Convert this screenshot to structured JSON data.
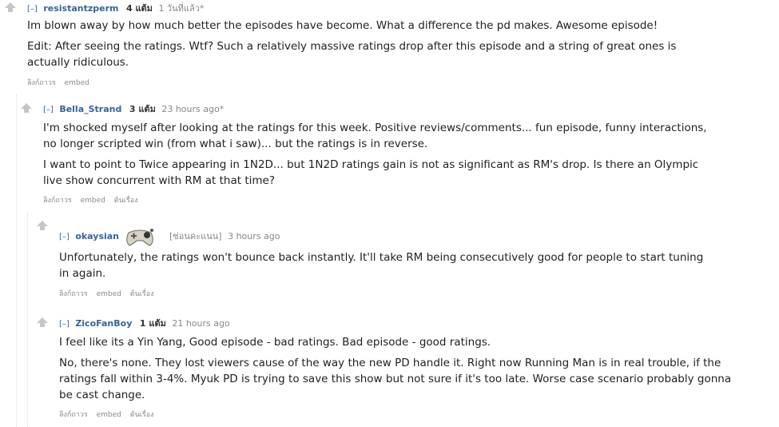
{
  "comments": [
    {
      "toggle": "[–]",
      "author": "resistantzperm",
      "points": "4 แต้ม",
      "time": "1 วันที่แล้ว*",
      "paragraphs": [
        "Im blown away by how much better the episodes have become. What a difference the pd makes. Awesome episode!",
        "Edit: After seeing the ratings. Wtf? Such a relatively massive ratings drop after this episode and a string of great ones is actually ridiculous."
      ],
      "buttons": [
        "ลิงก์ถาวร",
        "embed"
      ]
    },
    {
      "toggle": "[–]",
      "author": "Bella_Strand",
      "points": "3 แต้ม",
      "time": "23 hours ago*",
      "paragraphs": [
        "I'm shocked myself after looking at the ratings for this week. Positive reviews/comments... fun episode, funny interactions, no longer scripted win (from what i saw)... but the ratings is in reverse.",
        "I want to point to Twice appearing in 1N2D... but 1N2D ratings gain is not as significant as RM's drop. Is there an Olympic live show concurrent with RM at that time?"
      ],
      "buttons": [
        "ลิงก์ถาวร",
        "embed",
        "ต้นเรื่อง"
      ]
    },
    {
      "toggle": "[–]",
      "author": "okaysian",
      "hidden_score": "[ซ่อนคะแนน]",
      "time": "3 hours ago",
      "paragraphs": [
        "Unfortunately, the ratings won't bounce back instantly. It'll take RM being consecutively good for people to start tuning in again."
      ],
      "buttons": [
        "ลิงก์ถาวร",
        "embed",
        "ต้นเรื่อง"
      ]
    },
    {
      "toggle": "[–]",
      "author": "ZicoFanBoy",
      "points": "1 แต้ม",
      "time": "21 hours ago",
      "paragraphs": [
        "I feel like its a Yin Yang, Good episode - bad ratings. Bad episode - good ratings.",
        "No, there's none. They lost viewers cause of the way the new PD handle it. Right now Running Man is in real trouble, if the ratings fall within 3-4%. Myuk PD is trying to save this show but not sure if it's too late. Worse case scenario probably gonna be cast change."
      ],
      "buttons": [
        "ลิงก์ถาวร",
        "embed",
        "ต้นเรื่อง"
      ]
    }
  ],
  "icons": {
    "upvote": "upvote-arrow-icon",
    "flair": "game-controller-flair-icon"
  },
  "colors": {
    "author": "#336699",
    "muted": "#888888",
    "arrow": "#c6c6c6"
  }
}
